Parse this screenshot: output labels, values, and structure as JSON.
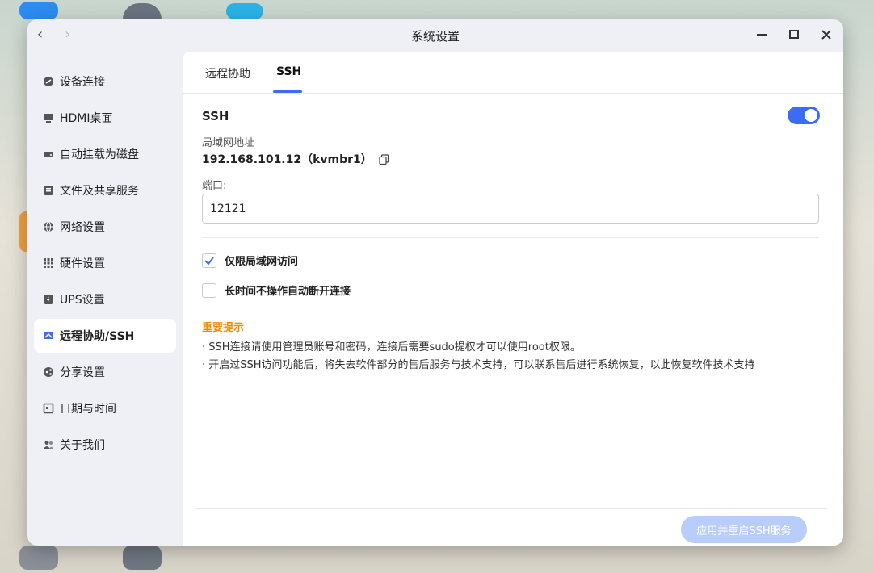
{
  "window": {
    "title": "系统设置",
    "back_icon": "‹",
    "forward_icon": "›"
  },
  "sidebar": {
    "items": [
      {
        "label": "设备连接",
        "icon": "link-icon"
      },
      {
        "label": "HDMI桌面",
        "icon": "monitor-icon"
      },
      {
        "label": "自动挂载为磁盘",
        "icon": "disk-icon"
      },
      {
        "label": "文件及共享服务",
        "icon": "file-share-icon"
      },
      {
        "label": "网络设置",
        "icon": "globe-icon"
      },
      {
        "label": "硬件设置",
        "icon": "grid-icon"
      },
      {
        "label": "UPS设置",
        "icon": "ups-icon"
      },
      {
        "label": "远程协助/SSH",
        "icon": "remote-icon",
        "active": true
      },
      {
        "label": "分享设置",
        "icon": "share-icon"
      },
      {
        "label": "日期与时间",
        "icon": "calendar-icon"
      },
      {
        "label": "关于我们",
        "icon": "people-icon"
      }
    ]
  },
  "tabs": [
    {
      "label": "远程协助"
    },
    {
      "label": "SSH",
      "active": true
    }
  ],
  "ssh": {
    "label": "SSH",
    "enabled": true,
    "lan_label": "局域网地址",
    "lan_value": "192.168.101.12（kvmbr1）",
    "port_label": "端口:",
    "port_value": "12121",
    "options": [
      {
        "label": "仅限局域网访问",
        "checked": true
      },
      {
        "label": "长时间不操作自动断开连接",
        "checked": false
      }
    ],
    "notice_title": "重要提示",
    "notice_lines": [
      "· SSH连接请使用管理员账号和密码，连接后需要sudo提权才可以使用root权限。",
      "· 开启过SSH访问功能后，将失去软件部分的售后服务与技术支持，可以联系售后进行系统恢复，以此恢复软件技术支持"
    ],
    "apply_label": "应用并重启SSH服务"
  },
  "colors": {
    "accent": "#3b6cf6",
    "notice": "#f08a00",
    "apply_disabled": "#b9cdfb"
  }
}
